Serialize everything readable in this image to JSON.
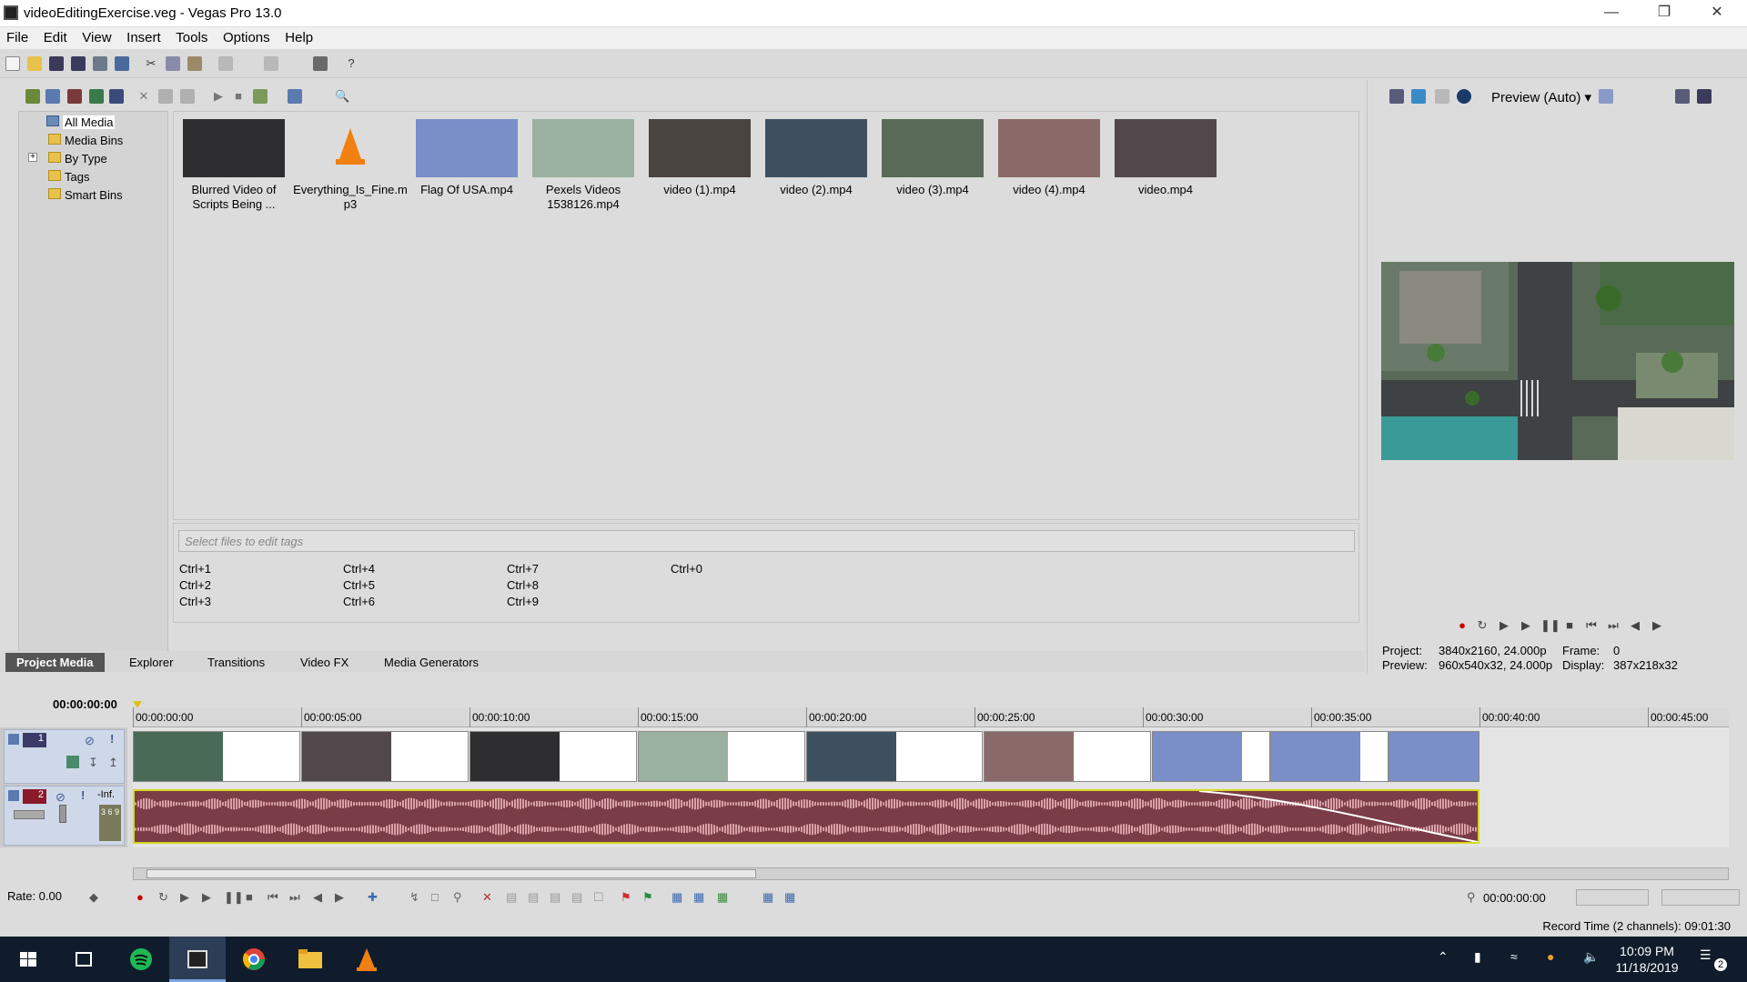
{
  "window": {
    "title": "videoEditingExercise.veg - Vegas Pro 13.0"
  },
  "menu": [
    "File",
    "Edit",
    "View",
    "Insert",
    "Tools",
    "Options",
    "Help"
  ],
  "tree": {
    "items": [
      {
        "label": "All Media",
        "selected": true
      },
      {
        "label": "Media Bins"
      },
      {
        "label": "By Type"
      },
      {
        "label": "Tags"
      },
      {
        "label": "Smart Bins"
      }
    ]
  },
  "media": [
    {
      "line1": "Blurred Video of",
      "line2": "Scripts Being ...",
      "color": "#2e2e30"
    },
    {
      "line1": "Everything_Is_Fine.m",
      "line2": "p3",
      "color": "#dcdcdc"
    },
    {
      "line1": "Flag Of USA.mp4",
      "line2": "",
      "color": "#7a8ec8"
    },
    {
      "line1": "Pexels Videos",
      "line2": "1538126.mp4",
      "color": "#9ab0a0"
    },
    {
      "line1": "video (1).mp4",
      "line2": "",
      "color": "#4a4440"
    },
    {
      "line1": "video (2).mp4",
      "line2": "",
      "color": "#3c5060"
    },
    {
      "line1": "video (3).mp4",
      "line2": "",
      "color": "#5a6a58"
    },
    {
      "line1": "video (4).mp4",
      "line2": "",
      "color": "#8a6a68"
    },
    {
      "line1": "video.mp4",
      "line2": "",
      "color": "#50484a"
    }
  ],
  "tags": {
    "placeholder": "Select files to edit tags",
    "shortcuts": [
      "Ctrl+1",
      "Ctrl+2",
      "Ctrl+3",
      "Ctrl+4",
      "Ctrl+5",
      "Ctrl+6",
      "Ctrl+7",
      "Ctrl+8",
      "Ctrl+9",
      "Ctrl+0"
    ]
  },
  "tabs": [
    "Project Media",
    "Explorer",
    "Transitions",
    "Video FX",
    "Media Generators"
  ],
  "preview": {
    "mode": "Preview (Auto)",
    "project_label": "Project:",
    "project_value": "3840x2160, 24.000p",
    "preview_label": "Preview:",
    "preview_value": "960x540x32, 24.000p",
    "frame_label": "Frame:",
    "frame_value": "0",
    "display_label": "Display:",
    "display_value": "387x218x32"
  },
  "timeline": {
    "position": "00:00:00:00",
    "ruler": [
      "00:00:00:00",
      "00:00:05:00",
      "00:00:10:00",
      "00:00:15:00",
      "00:00:20:00",
      "00:00:25:00",
      "00:00:30:00",
      "00:00:35:00",
      "00:00:40:00",
      "00:00:45:00"
    ],
    "track1_num": "1",
    "track2_num": "2",
    "track2_vol": "-Inf.",
    "meter": "3 6 9",
    "rate": "Rate: 0.00",
    "time_field": "00:00:00:00",
    "record_time": "Record Time (2 channels): 09:01:30"
  },
  "taskbar": {
    "time": "10:09 PM",
    "date": "11/18/2019",
    "notifications": "2"
  }
}
